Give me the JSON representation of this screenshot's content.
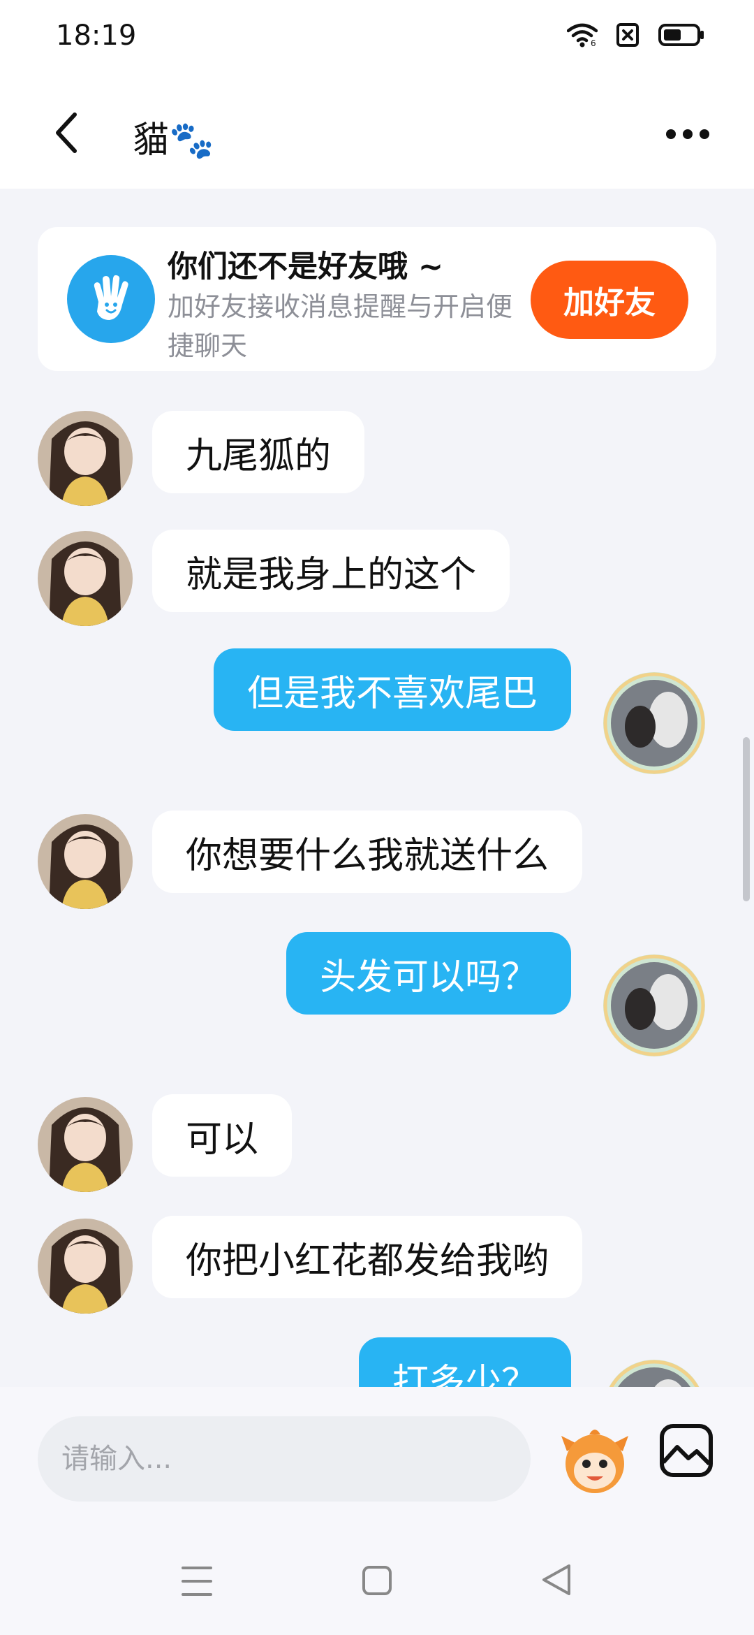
{
  "status_bar": {
    "time": "18:19",
    "icons": [
      "wifi-icon",
      "sim-off-icon",
      "battery-icon"
    ]
  },
  "header": {
    "title": "貓🐾",
    "back_icon": "chevron-left-icon",
    "more_icon": "more-horizontal-icon"
  },
  "friend_banner": {
    "icon": "waving-hand-icon",
    "title": "你们还不是好友哦 ~",
    "description": "加好友接收消息提醒与开启便捷聊天",
    "button_label": "加好友"
  },
  "messages": [
    {
      "side": "in",
      "text": "九尾狐的"
    },
    {
      "side": "in",
      "text": "就是我身上的这个"
    },
    {
      "side": "out",
      "text": "但是我不喜欢尾巴"
    },
    {
      "side": "in",
      "text": "你想要什么我就送什么"
    },
    {
      "side": "out",
      "text": "头发可以吗？"
    },
    {
      "side": "in",
      "text": "可以"
    },
    {
      "side": "in",
      "text": "你把小红花都发给我哟"
    },
    {
      "side": "out",
      "text": "打多少？"
    }
  ],
  "input": {
    "placeholder": "请输入..."
  },
  "colors": {
    "accent": "#28b4f3",
    "add_friend": "#ff5a12",
    "background": "#f3f4f9"
  },
  "nav": {
    "icons": [
      "menu-icon",
      "home-square-icon",
      "back-triangle-icon"
    ]
  }
}
